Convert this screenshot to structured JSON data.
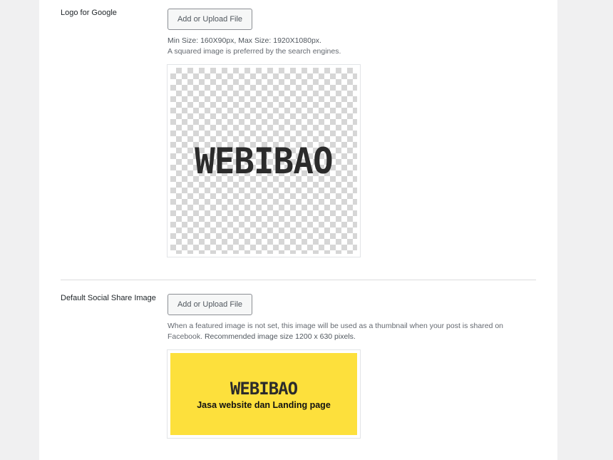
{
  "logo_google": {
    "label": "Logo for Google",
    "button_label": "Add or Upload File",
    "desc_line1": "Min Size: 160X90px, Max Size: 1920X1080px.",
    "desc_line2": "A squared image is preferred by the search engines.",
    "logo_text": "WEBIBAO"
  },
  "social_share": {
    "label": "Default Social Share Image",
    "button_label": "Add or Upload File",
    "desc_line1": "When a featured image is not set, this image will be used as a thumbnail when your post is shared on",
    "desc_line2_a": "Facebook.",
    "desc_line2_b": "Recommended image size 1200 x 630 pixels.",
    "logo_text": "WEBIBAO",
    "tagline": "Jasa website dan Landing page",
    "bg_color": "#fde03c"
  }
}
